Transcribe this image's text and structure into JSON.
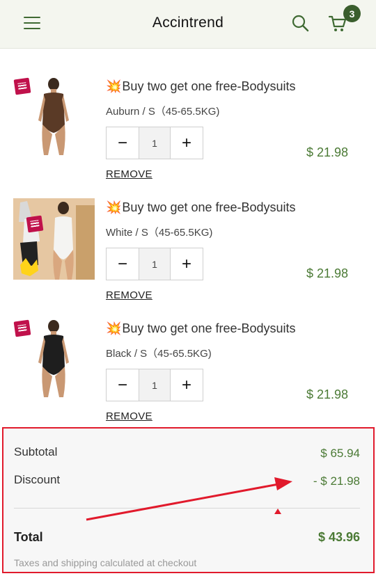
{
  "header": {
    "brand": "Accintrend",
    "cart_count": "3",
    "menu_icon": "hamburger-menu-icon",
    "search_icon": "search-icon",
    "cart_icon": "shopping-cart-icon",
    "accent_color": "#3a5e2d"
  },
  "cart": {
    "items": [
      {
        "title": "Buy two get one free-Bodysuits",
        "variant": "Auburn / S（45-65.5KG)",
        "quantity": "1",
        "price": "$ 21.98",
        "remove_label": "REMOVE",
        "thumb_color": "#5a3a26"
      },
      {
        "title": "Buy two get one free-Bodysuits",
        "variant": "White / S（45-65.5KG)",
        "quantity": "1",
        "price": "$ 21.98",
        "remove_label": "REMOVE",
        "thumb_color": "#ffffff"
      },
      {
        "title": "Buy two get one free-Bodysuits",
        "variant": "Black / S（45-65.5KG)",
        "quantity": "1",
        "price": "$ 21.98",
        "remove_label": "REMOVE",
        "thumb_color": "#1e1e1e"
      }
    ]
  },
  "summary": {
    "subtotal_label": "Subtotal",
    "subtotal_value": "$ 65.94",
    "discount_label": "Discount",
    "discount_value": "- $ 21.98",
    "total_label": "Total",
    "total_value": "$ 43.96",
    "note": "Taxes and shipping calculated at checkout",
    "highlight_color": "#e11a2c",
    "price_color": "#4b7a35"
  }
}
